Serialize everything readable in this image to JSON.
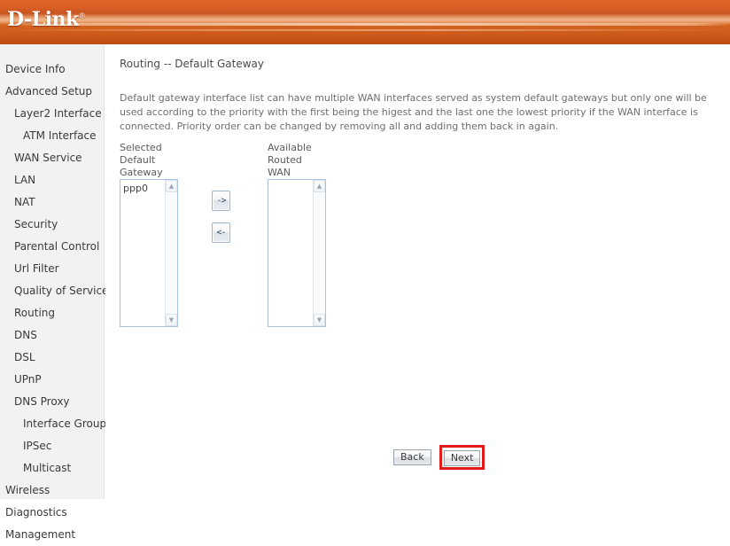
{
  "header": {
    "logo_text": "D-Link",
    "logo_tm": "®"
  },
  "sidebar": {
    "items": [
      {
        "label": "Device Info",
        "level": 1
      },
      {
        "label": "Advanced Setup",
        "level": 1
      },
      {
        "label": "Layer2 Interface",
        "level": 2
      },
      {
        "label": "ATM Interface",
        "level": 3
      },
      {
        "label": "WAN Service",
        "level": 2
      },
      {
        "label": "LAN",
        "level": 2
      },
      {
        "label": "NAT",
        "level": 2
      },
      {
        "label": "Security",
        "level": 2
      },
      {
        "label": "Parental Control",
        "level": 2
      },
      {
        "label": "Url Filter",
        "level": 2
      },
      {
        "label": "Quality of Service",
        "level": 2
      },
      {
        "label": "Routing",
        "level": 2
      },
      {
        "label": "DNS",
        "level": 2
      },
      {
        "label": "DSL",
        "level": 2
      },
      {
        "label": "UPnP",
        "level": 2
      },
      {
        "label": "DNS Proxy",
        "level": 2
      },
      {
        "label": "Interface Grouping",
        "level": 3
      },
      {
        "label": "IPSec",
        "level": 3
      },
      {
        "label": "Multicast",
        "level": 3
      },
      {
        "label": "Wireless",
        "level": 1
      },
      {
        "label": "Diagnostics",
        "level": 1
      },
      {
        "label": "Management",
        "level": 1
      }
    ]
  },
  "main": {
    "title": "Routing -- Default Gateway",
    "description": "Default gateway interface list can have multiple WAN interfaces served as system default gateways but only one will be used according to the priority with the first being the higest and the last one the lowest priority if the WAN interface is connected. Priority order can be changed by removing all and adding them back in again.",
    "transfer": {
      "left_label": "Selected Default\nGateway Interfaces",
      "right_label": "Available Routed WAN\nInterfaces",
      "left_options": [
        "ppp0"
      ],
      "right_options": [],
      "move_right_label": "->",
      "move_left_label": "<-",
      "scroll_up_glyph": "▲",
      "scroll_down_glyph": "▼"
    },
    "buttons": {
      "back_label": "Back",
      "next_label": "Next"
    }
  },
  "colors": {
    "brand_orange": "#d4621f",
    "highlight_red": "#e21b1b",
    "listbox_border": "#a9c2dd",
    "sidebar_bg": "#f2f2f2"
  }
}
